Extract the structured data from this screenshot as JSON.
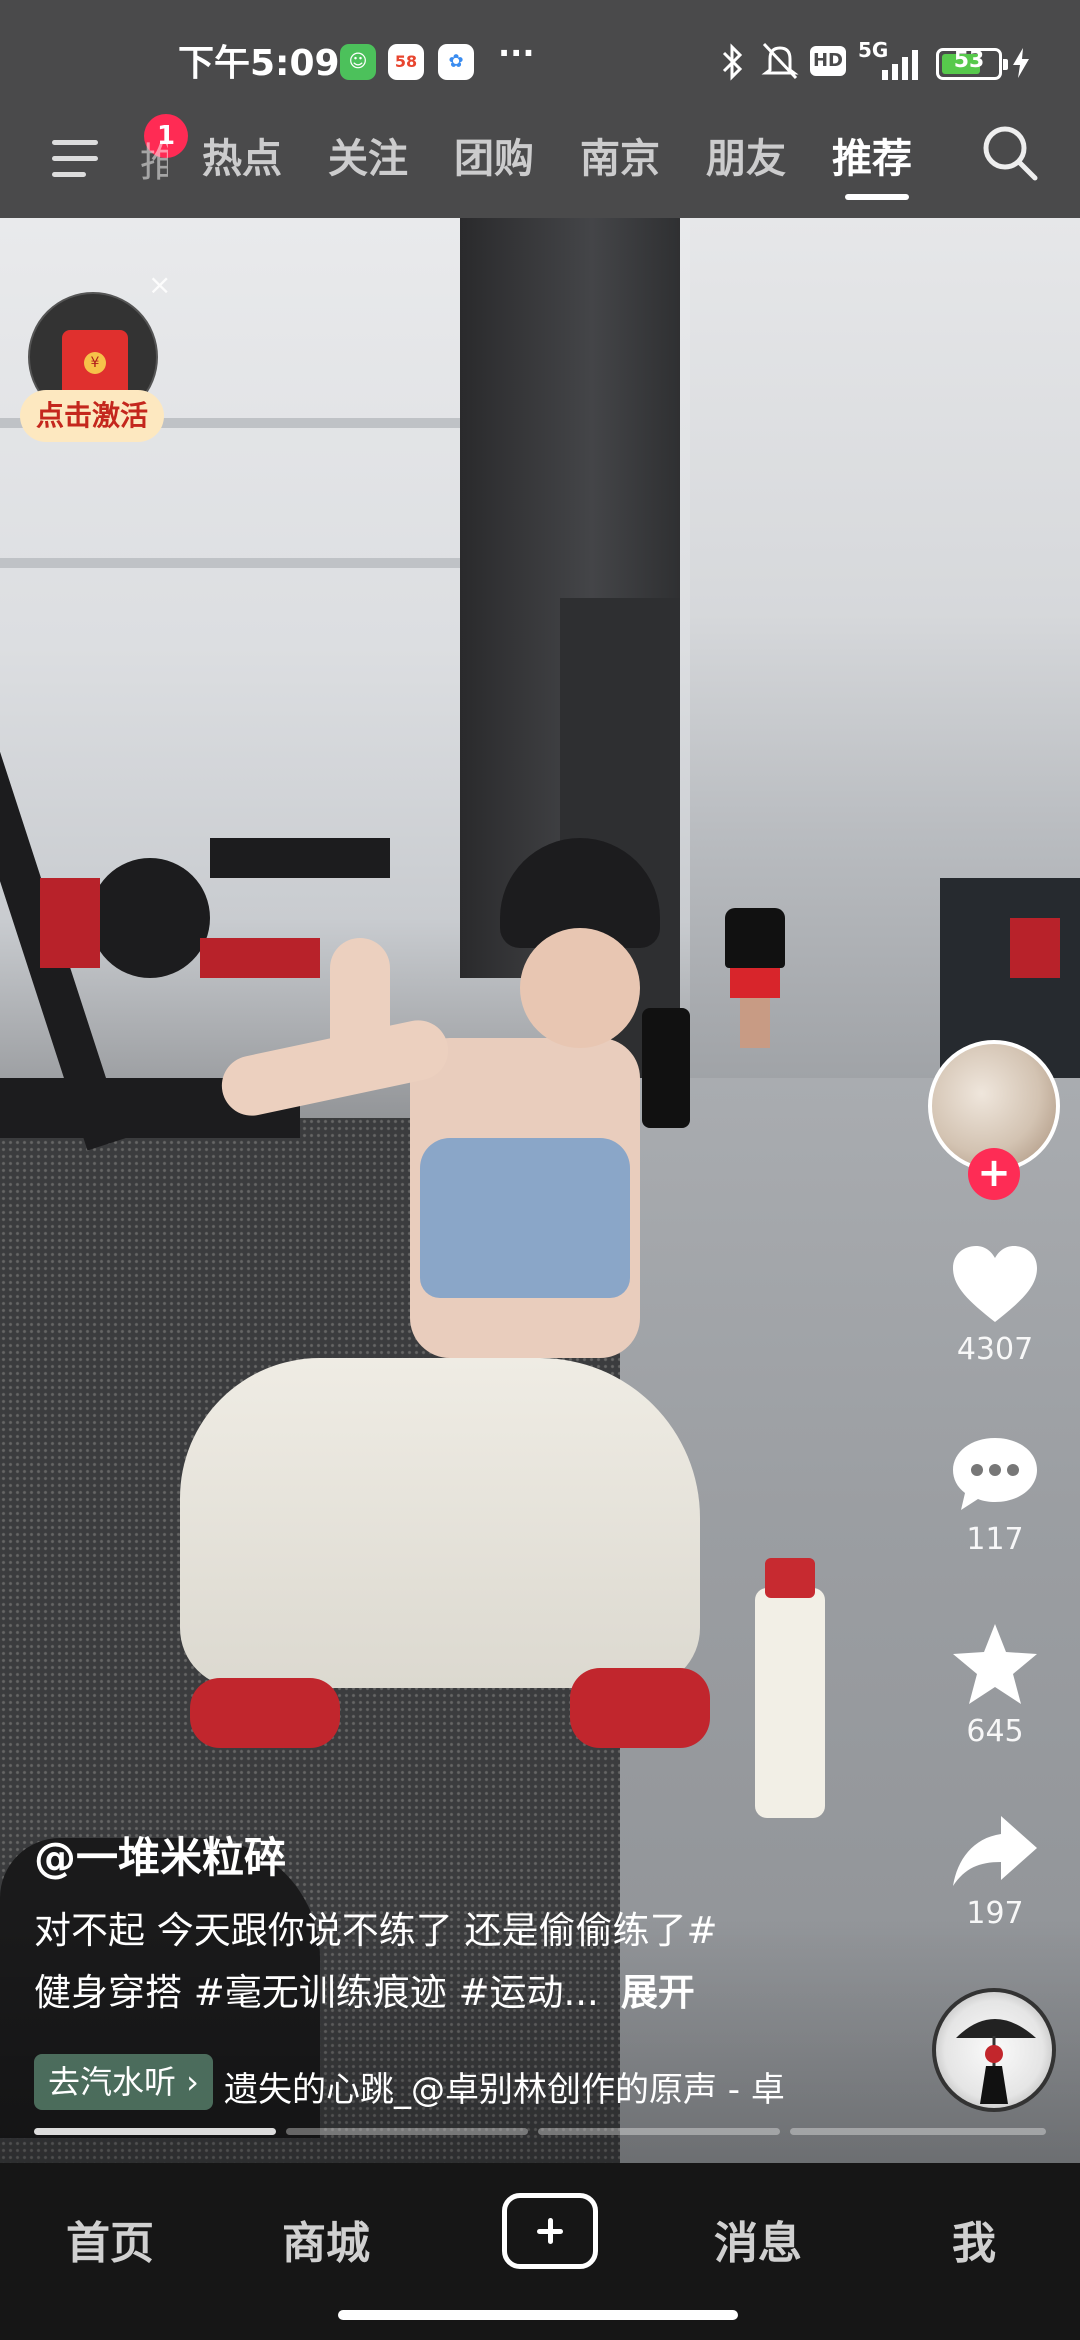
{
  "status_bar": {
    "time": "下午5:09",
    "dots": "···",
    "network": "5G",
    "hd": "HD",
    "battery": "53",
    "icons": [
      "wechat-icon",
      "58-app-icon",
      "cloud-app-icon",
      "bluetooth-icon",
      "mute-bell-icon",
      "signal-icon",
      "charging-icon"
    ]
  },
  "top_nav": {
    "menu_badge": "1",
    "faded_tab": "推荐",
    "tabs": [
      "热点",
      "关注",
      "团购",
      "南京",
      "朋友",
      "推荐"
    ],
    "active_tab": "推荐"
  },
  "red_packet": {
    "label": "点击激活",
    "close": "×",
    "seal": "¥"
  },
  "actions": {
    "likes": "4307",
    "comments": "117",
    "favorites": "645",
    "shares": "197"
  },
  "video": {
    "author": "@一堆米粒碎",
    "caption_line1": "对不起 今天跟你说不练了 还是偷偷练了#",
    "caption_line2": "健身穿搭 #毫无训练痕迹 #运动...",
    "expand": "展开",
    "music_chip": "去汽水听 ›",
    "music_title": "遗失的心跳_@卓别林创作的原声 - 卓",
    "progress_segments": 4,
    "progress_done": 1
  },
  "bottom_nav": {
    "items": [
      "首页",
      "商城",
      "消息",
      "我"
    ],
    "add_icon": "plus-icon"
  },
  "colors": {
    "accent_red": "#fe2c55",
    "nav_bg": "#4a4a4b",
    "battery_green": "#57c94c"
  }
}
